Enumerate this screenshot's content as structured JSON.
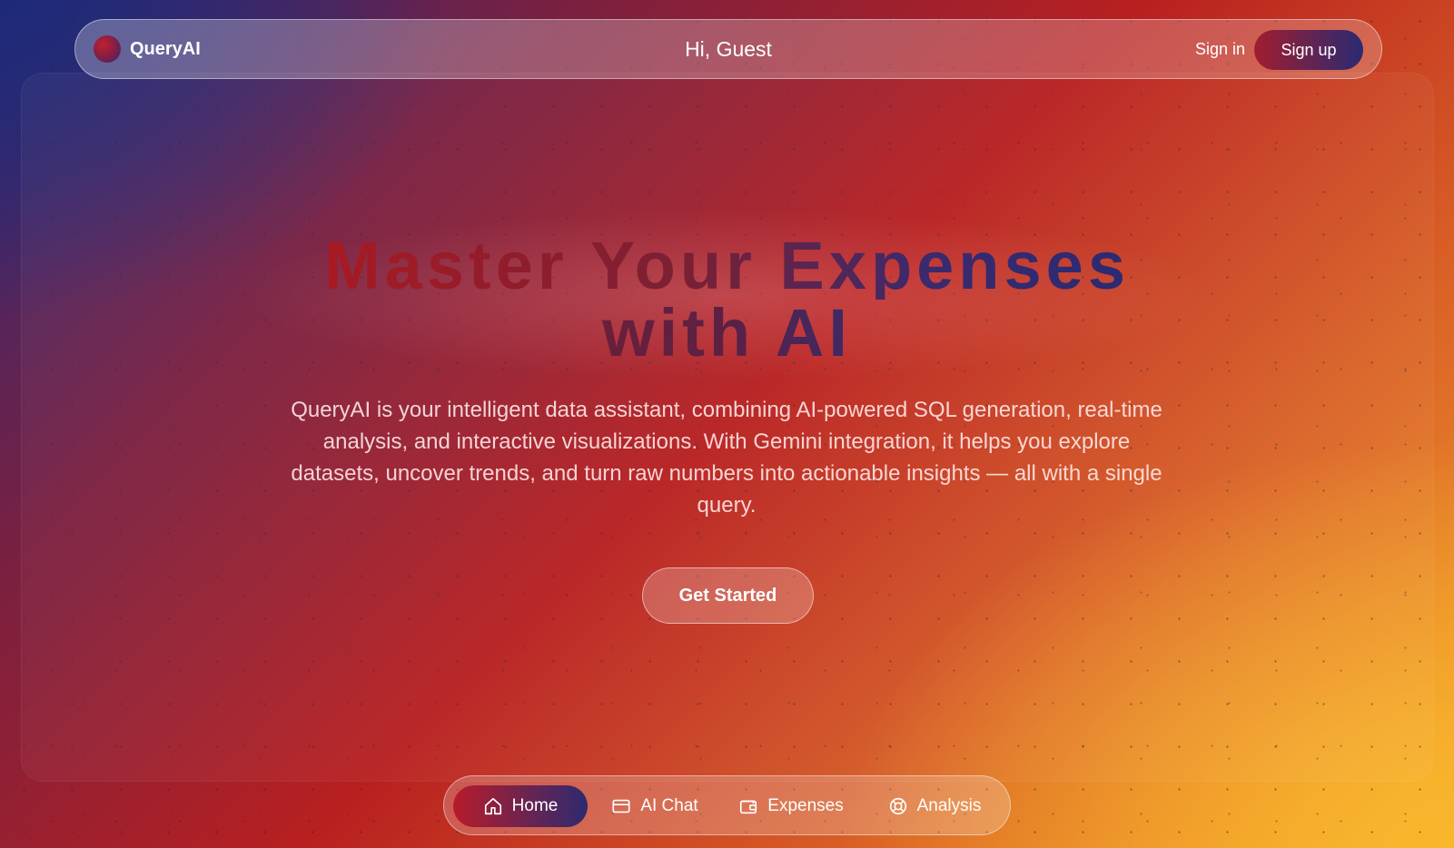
{
  "header": {
    "brand": "QueryAI",
    "greeting": "Hi, Guest",
    "sign_in": "Sign in",
    "sign_up": "Sign up"
  },
  "hero": {
    "title_line1": "Master Your Expenses",
    "title_line2": "with AI",
    "description": "QueryAI is your intelligent data assistant, combining AI-powered SQL generation, real-time analysis, and interactive visualizations. With Gemini integration, it helps you explore datasets, uncover trends, and turn raw numbers into actionable insights — all with a single query.",
    "cta": "Get Started"
  },
  "bottom_nav": {
    "items": [
      {
        "label": "Home",
        "icon": "home-icon",
        "active": true
      },
      {
        "label": "AI Chat",
        "icon": "card-icon",
        "active": false
      },
      {
        "label": "Expenses",
        "icon": "wallet-icon",
        "active": false
      },
      {
        "label": "Analysis",
        "icon": "lifebuoy-icon",
        "active": false
      }
    ]
  },
  "colors": {
    "accent_red": "#b71c2a",
    "accent_navy": "#2d2a70",
    "gradient_orange": "#f5a22c"
  }
}
